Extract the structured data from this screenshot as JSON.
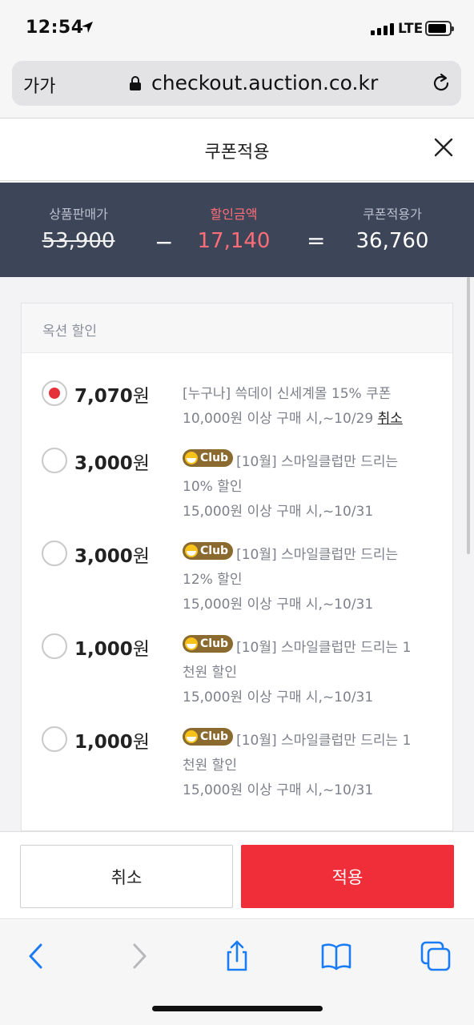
{
  "status_bar": {
    "time": "12:54",
    "network": "LTE"
  },
  "browser": {
    "text_size_button": "가가",
    "domain": "checkout.auction.co.kr"
  },
  "header": {
    "title": "쿠폰적용"
  },
  "summary": {
    "original_label": "상품판매가",
    "original_price": "53,900",
    "minus": "−",
    "discount_label": "할인금액",
    "discount_amount": "17,140",
    "equals": "=",
    "final_label": "쿠폰적용가",
    "final_price": "36,760"
  },
  "section": {
    "title": "옥션 할인",
    "coupons": [
      {
        "amount": "7,070",
        "unit": "원",
        "selected": true,
        "line1": "[누구나] 쓱데이 신세계몰 15% 쿠폰",
        "line2": "10,000원 이상 구매 시,~10/29",
        "cancel": "취소"
      },
      {
        "amount": "3,000",
        "unit": "원",
        "selected": false,
        "badge": "Club",
        "line1": "[10월] 스마일클럽만 드리는",
        "line2": "10% 할인",
        "line3": "15,000원 이상 구매 시,~10/31"
      },
      {
        "amount": "3,000",
        "unit": "원",
        "selected": false,
        "badge": "Club",
        "line1": "[10월] 스마일클럽만 드리는",
        "line2": "12% 할인",
        "line3": "15,000원 이상 구매 시,~10/31"
      },
      {
        "amount": "1,000",
        "unit": "원",
        "selected": false,
        "badge": "Club",
        "line1": "[10월] 스마일클럽만 드리는 1",
        "line2": "천원 할인",
        "line3": "15,000원 이상 구매 시,~10/31"
      },
      {
        "amount": "1,000",
        "unit": "원",
        "selected": false,
        "badge": "Club",
        "line1": "[10월] 스마일클럽만 드리는 1",
        "line2": "천원 할인",
        "line3": "15,000원 이상 구매 시,~10/31"
      }
    ]
  },
  "actions": {
    "cancel": "취소",
    "apply": "적용"
  },
  "colors": {
    "summary_bg": "#3d4558",
    "discount": "#ff6d78",
    "apply_bg": "#ef2e39",
    "radio_selected": "#e5313a",
    "club_badge": "#8b6a2f",
    "safari_blue": "#1a7cf5"
  },
  "icons": [
    "location-arrow-icon",
    "signal-icon",
    "battery-icon",
    "lock-icon",
    "reload-icon",
    "close-icon",
    "back-icon",
    "forward-icon",
    "share-icon",
    "bookmarks-icon",
    "tabs-icon",
    "club-badge-icon"
  ]
}
